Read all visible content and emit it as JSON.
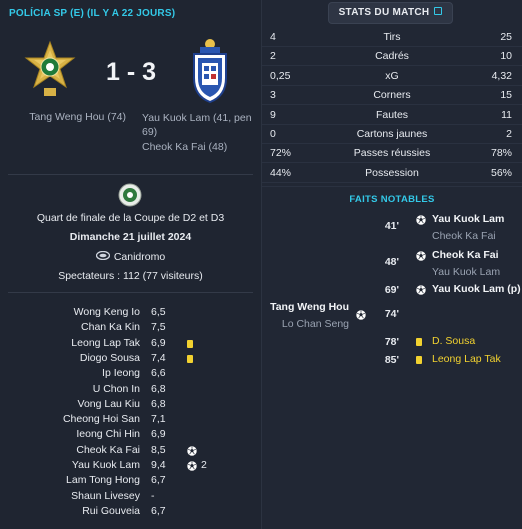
{
  "header": {
    "title": "POLÍCIA SP (E) (IL Y A 22 JOURS)"
  },
  "match": {
    "score": "1 - 3",
    "home_scorers": [
      "Tang Weng Hou (74)"
    ],
    "away_scorers": [
      "Yau Kuok Lam (41, pen",
      "69)",
      "Cheok Ka Fai (48)"
    ],
    "competition": "Quart de finale de la Coupe de D2 et D3",
    "date": "Dimanche 21 juillet 2024",
    "stadium": "Canidromo",
    "attendance": "Spectateurs : 112 (77 visiteurs)"
  },
  "players": [
    {
      "name": "Wong Keng Io",
      "rating": "6,5",
      "event": "",
      "count": ""
    },
    {
      "name": "Chan Ka Kin",
      "rating": "7,5",
      "event": "",
      "count": ""
    },
    {
      "name": "Leong Lap Tak",
      "rating": "6,9",
      "event": "yellow-card",
      "count": ""
    },
    {
      "name": "Diogo Sousa",
      "rating": "7,4",
      "event": "yellow-card",
      "count": ""
    },
    {
      "name": "Ip Ieong",
      "rating": "6,6",
      "event": "",
      "count": ""
    },
    {
      "name": "U Chon In",
      "rating": "6,8",
      "event": "",
      "count": ""
    },
    {
      "name": "Vong Lau Kiu",
      "rating": "6,8",
      "event": "",
      "count": ""
    },
    {
      "name": "Cheong Hoi San",
      "rating": "7,1",
      "event": "",
      "count": ""
    },
    {
      "name": "Ieong Chi Hin",
      "rating": "6,9",
      "event": "",
      "count": ""
    },
    {
      "name": "Cheok Ka Fai",
      "rating": "8,5",
      "event": "goal",
      "count": ""
    },
    {
      "name": "Yau Kuok Lam",
      "rating": "9,4",
      "event": "goal",
      "count": "2"
    },
    {
      "name": "Lam Tong Hong",
      "rating": "6,7",
      "event": "",
      "count": ""
    },
    {
      "name": "Shaun Livesey",
      "rating": "-",
      "event": "",
      "count": ""
    },
    {
      "name": "Rui Gouveia",
      "rating": "6,7",
      "event": "",
      "count": ""
    }
  ],
  "stats_button": {
    "label": "STATS DU MATCH",
    "icon": "external-link-icon"
  },
  "stats": [
    {
      "home": "4",
      "label": "Tirs",
      "away": "25"
    },
    {
      "home": "2",
      "label": "Cadrés",
      "away": "10"
    },
    {
      "home": "0,25",
      "label": "xG",
      "away": "4,32"
    },
    {
      "home": "3",
      "label": "Corners",
      "away": "15"
    },
    {
      "home": "9",
      "label": "Fautes",
      "away": "11"
    },
    {
      "home": "0",
      "label": "Cartons jaunes",
      "away": "2"
    },
    {
      "home": "72%",
      "label": "Passes réussies",
      "away": "78%"
    },
    {
      "home": "44%",
      "label": "Possession",
      "away": "56%"
    }
  ],
  "facts": {
    "title": "FAITS NOTABLES",
    "events": [
      {
        "minute": "41'",
        "side": "away",
        "type": "goal",
        "main": "Yau Kuok Lam",
        "sub": "Cheok Ka Fai"
      },
      {
        "minute": "48'",
        "side": "away",
        "type": "goal",
        "main": "Cheok Ka Fai",
        "sub": "Yau Kuok Lam"
      },
      {
        "minute": "69'",
        "side": "away",
        "type": "goal",
        "main": "Yau Kuok Lam (p)",
        "sub": ""
      },
      {
        "minute": "74'",
        "side": "home",
        "type": "goal",
        "main": "Tang Weng Hou",
        "sub": "Lo Chan Seng"
      },
      {
        "minute": "78'",
        "side": "away",
        "type": "yellow-card",
        "main": "D. Sousa",
        "sub": ""
      },
      {
        "minute": "85'",
        "side": "away",
        "type": "yellow-card",
        "main": "Leong Lap Tak",
        "sub": ""
      }
    ]
  },
  "colors": {
    "accent": "#33c9e8",
    "yellow_card": "#f2d230",
    "background": "#1e2430"
  }
}
